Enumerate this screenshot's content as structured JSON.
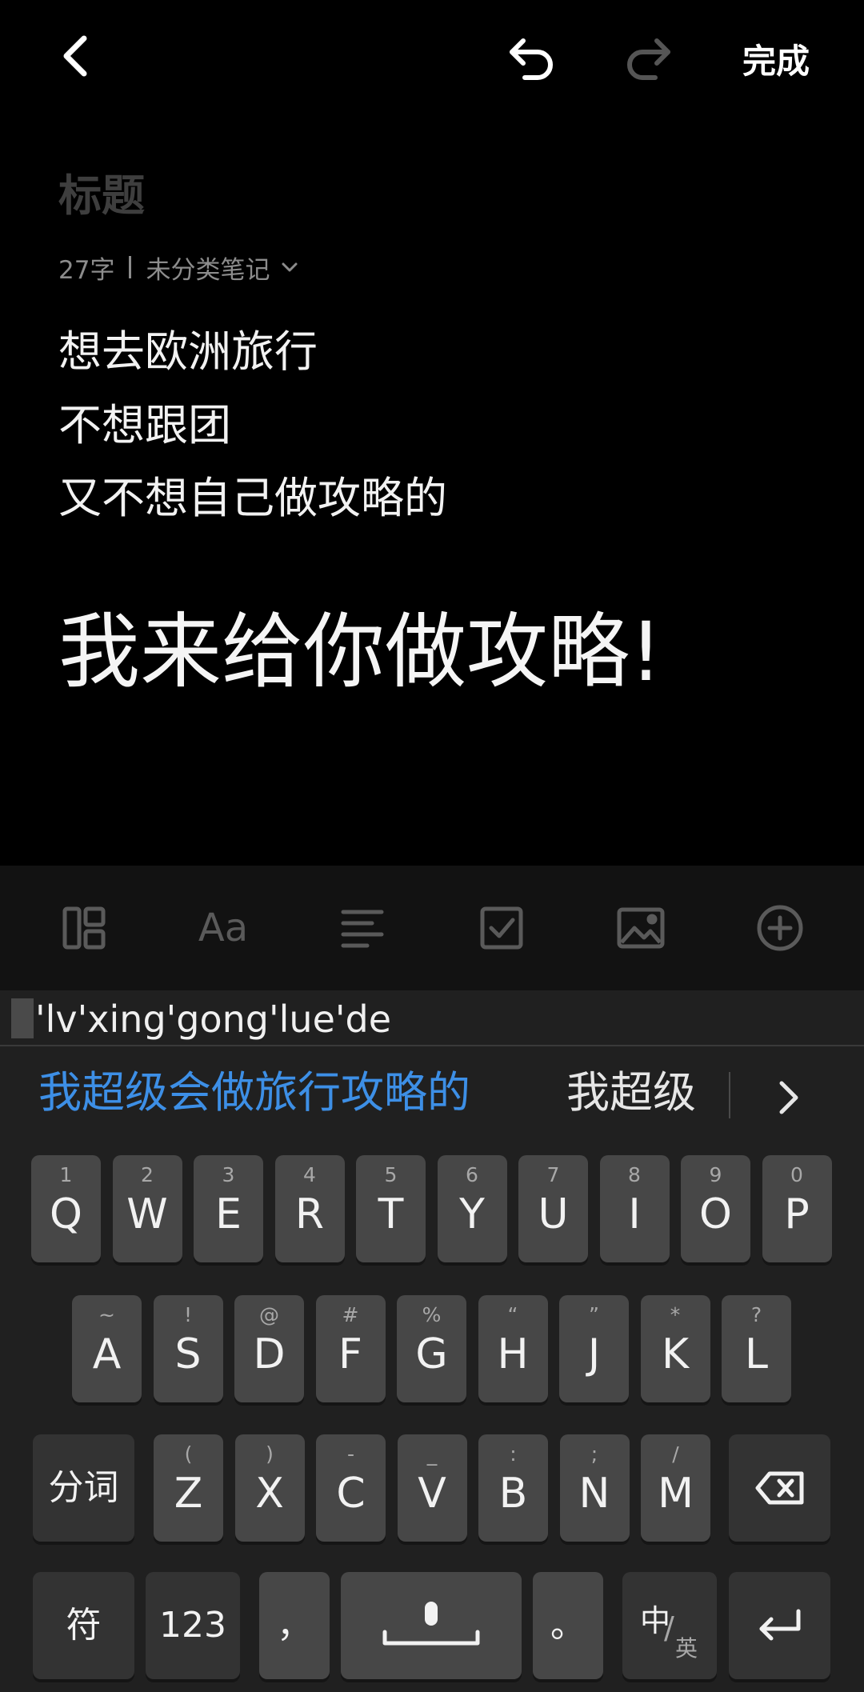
{
  "topbar": {
    "done_label": "完成"
  },
  "note": {
    "title_placeholder": "标题",
    "word_count": "27字",
    "category": "未分类笔记",
    "lines": [
      "想去欧洲旅行",
      "不想跟团",
      "又不想自己做攻略的"
    ],
    "highlight_line": "我来给你做攻略!"
  },
  "toolbar_icons": [
    "layout-icon",
    "text-format-icon",
    "align-icon",
    "checkbox-icon",
    "image-icon",
    "add-circle-icon"
  ],
  "ime": {
    "composition": "'lv'xing'gong'lue'de",
    "candidates": [
      "我超级会做旅行攻略的",
      "我超级"
    ],
    "row1": [
      {
        "k": "Q",
        "s": "1"
      },
      {
        "k": "W",
        "s": "2"
      },
      {
        "k": "E",
        "s": "3"
      },
      {
        "k": "R",
        "s": "4"
      },
      {
        "k": "T",
        "s": "5"
      },
      {
        "k": "Y",
        "s": "6"
      },
      {
        "k": "U",
        "s": "7"
      },
      {
        "k": "I",
        "s": "8"
      },
      {
        "k": "O",
        "s": "9"
      },
      {
        "k": "P",
        "s": "0"
      }
    ],
    "row2": [
      {
        "k": "A",
        "s": "~"
      },
      {
        "k": "S",
        "s": "!"
      },
      {
        "k": "D",
        "s": "@"
      },
      {
        "k": "F",
        "s": "#"
      },
      {
        "k": "G",
        "s": "%"
      },
      {
        "k": "H",
        "s": "“"
      },
      {
        "k": "J",
        "s": "”"
      },
      {
        "k": "K",
        "s": "*"
      },
      {
        "k": "L",
        "s": "?"
      }
    ],
    "row3": [
      {
        "k": "Z",
        "s": "("
      },
      {
        "k": "X",
        "s": ")"
      },
      {
        "k": "C",
        "s": "-"
      },
      {
        "k": "V",
        "s": "_"
      },
      {
        "k": "B",
        "s": ":"
      },
      {
        "k": "N",
        "s": ";"
      },
      {
        "k": "M",
        "s": "/"
      }
    ],
    "segment_label": "分词",
    "symbol_label": "符",
    "numeric_label": "123",
    "comma_label": "，",
    "period_label": "。",
    "lang_primary": "中",
    "lang_secondary": "英"
  }
}
